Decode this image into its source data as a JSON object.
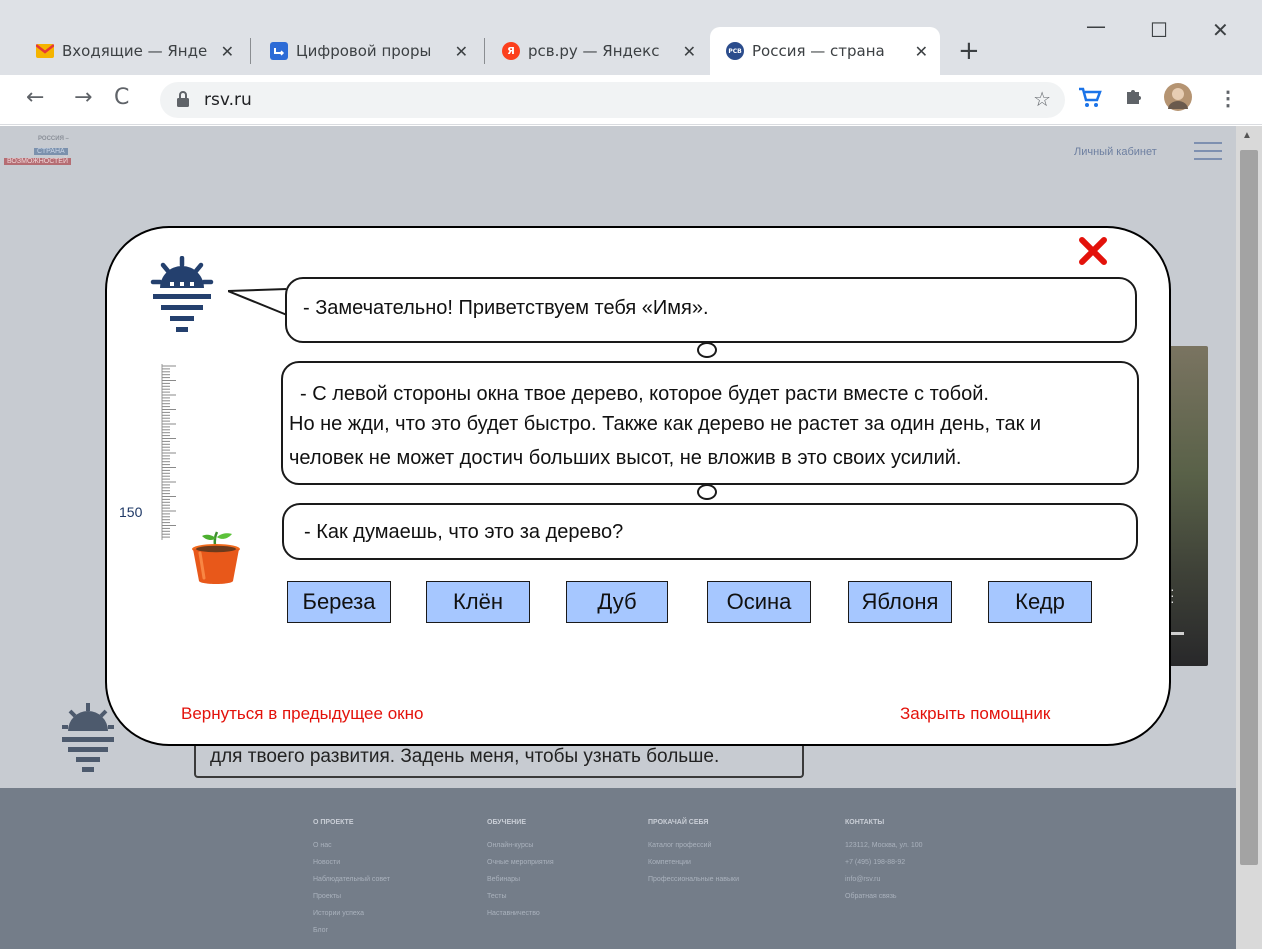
{
  "browser": {
    "tabs": [
      {
        "title": "Входящие — Янде",
        "icon": "yandex-mail-icon"
      },
      {
        "title": "Цифровой проры",
        "icon": "tab-app-icon"
      },
      {
        "title": "рсв.ру — Яндекс",
        "icon": "yandex-icon"
      },
      {
        "title": "Россия — страна",
        "icon": "rsv-icon",
        "favicon_text": "РСВ"
      }
    ],
    "tab_close": "✕",
    "new_tab": "+",
    "url": "rsv.ru"
  },
  "site": {
    "logo_line1": "РОССИЯ –",
    "logo_line2": "СТРАНА",
    "logo_line3": "ВОЗМОЖНОСТЕЙ",
    "cabinet": "Личный кабинет",
    "background_bubble_text": "для твоего развития. Задень меня, чтобы узнать больше.",
    "footer": {
      "col1": {
        "heading": "О ПРОЕКТЕ",
        "items": [
          "О нас",
          "Новости",
          "Наблюдательный совет",
          "Проекты",
          "Истории успеха",
          "Блог"
        ]
      },
      "col2": {
        "heading": "ОБУЧЕНИЕ",
        "items": [
          "Онлайн-курсы",
          "Очные мероприятия",
          "Вебинары",
          "Тесты",
          "Наставничество"
        ]
      },
      "col3": {
        "heading": "ПРОКАЧАЙ СЕБЯ",
        "items": [
          "Каталог профессий",
          "Компетенции",
          "Профессиональные навыки"
        ]
      },
      "col4": {
        "heading": "КОНТАКТЫ",
        "items": [
          "123112, Москва, ул. 100",
          "+7 (495) 198-88-92",
          "info@rsv.ru",
          "",
          "Обратная связь"
        ]
      }
    }
  },
  "assistant": {
    "message1": "-  Замечательно! Приветствуем тебя «Имя».",
    "message2": "-  С левой стороны окна твое дерево, которое будет расти вместе с тобой.",
    "message2_line2": "Но не жди, что это будет быстро. Также как дерево не растет за один день, так и",
    "message2_line3": "человек не может достич больших высот, не вложив в это своих усилий.",
    "message3": "-  Как думаешь, что это за дерево?",
    "ruler_label": "150",
    "options": [
      "Береза",
      "Клён",
      "Дуб",
      "Осина",
      "Яблоня",
      "Кедр"
    ],
    "back_link": "Вернуться в предыдущее окно",
    "close_link": "Закрыть помощник"
  },
  "colors": {
    "accent_red": "#e3120b",
    "option_fill": "#a6c7ff",
    "dim_overlay": "#c7cbd1",
    "helper_blue": "#24406e"
  }
}
